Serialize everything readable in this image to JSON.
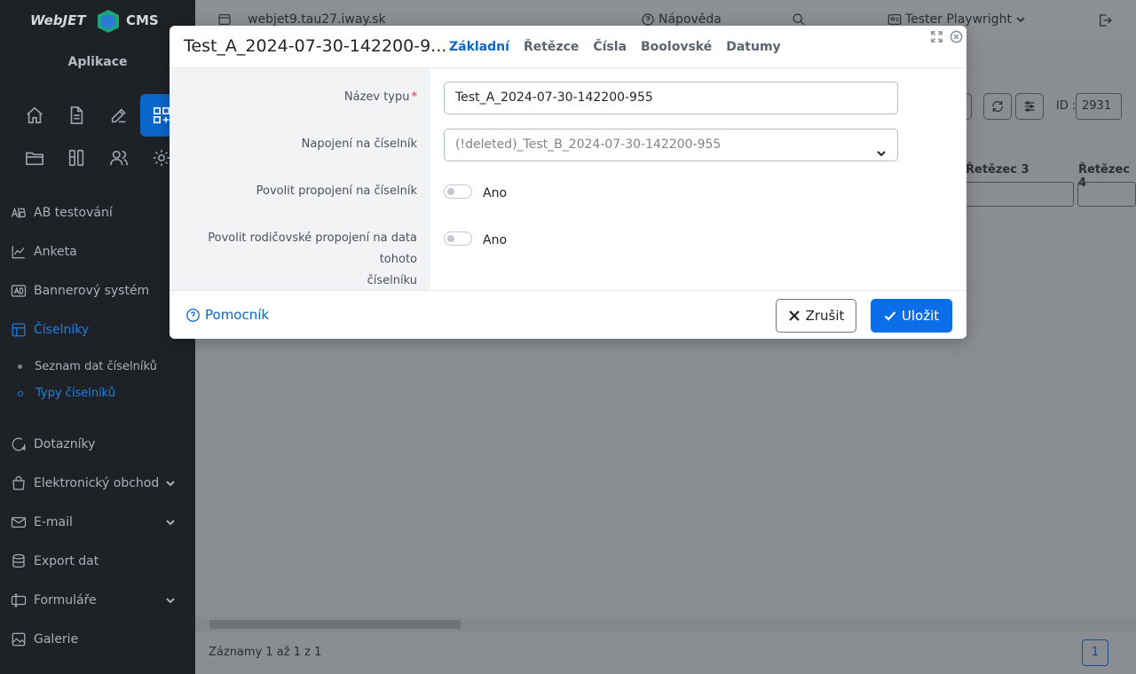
{
  "colors": {
    "accent": "#0a67c9",
    "sidebar_bg": "#1e2227",
    "required": "#dc3545",
    "overlay": "#868b90"
  },
  "sidebar": {
    "logo_text": "WebJET CMS",
    "apps_title": "Aplikace",
    "app_icons": [
      "home-icon",
      "document-icon",
      "edit-icon",
      "apps-grid-icon",
      "folder-icon",
      "columns-icon",
      "users-icon",
      "gear-icon"
    ],
    "nav": [
      {
        "label": "AB testování",
        "icon": "ab-icon"
      },
      {
        "label": "Anketa",
        "icon": "chart-icon"
      },
      {
        "label": "Bannerový systém",
        "icon": "ad-icon"
      },
      {
        "label": "Číselníky",
        "icon": "table-icon",
        "active": true
      },
      {
        "label": "Dotazníky",
        "icon": "chat-icon"
      },
      {
        "label": "Elektronický obchod",
        "icon": "bag-icon",
        "expandable": true
      },
      {
        "label": "E-mail",
        "icon": "mail-icon",
        "expandable": true
      },
      {
        "label": "Export dat",
        "icon": "database-icon"
      },
      {
        "label": "Formuláře",
        "icon": "form-icon",
        "expandable": true
      },
      {
        "label": "Galerie",
        "icon": "image-icon"
      }
    ],
    "sub_items": [
      {
        "label": "Seznam dat číselníků"
      },
      {
        "label": "Typy číselníků",
        "active": true
      }
    ]
  },
  "topbar": {
    "domain": "webjet9.tau27.iway.sk",
    "help": "Nápověda",
    "user": "Tester Playwright"
  },
  "table": {
    "id_label": "ID :",
    "id_value": "2931",
    "columns": [
      "Řetězec 3",
      "Řetězec 4"
    ],
    "footer": "Záznamy 1 až 1 z 1",
    "page": "1"
  },
  "modal": {
    "title": "Test_A_2024-07-30-142200-9...",
    "tabs": [
      "Základní",
      "Řetězce",
      "Čísla",
      "Boolovské",
      "Datumy"
    ],
    "fields": {
      "type_name_label": "Název typu",
      "type_name_value": "Test_A_2024-07-30-142200-955",
      "link_label": "Napojení na číselník",
      "link_value": "(!deleted)_Test_B_2024-07-30-142200-955",
      "allow_link_label": "Povolit propojení na číselník",
      "allow_link_text": "Ano",
      "allow_parent_label_line1": "Povolit rodičovské propojení na data tohoto",
      "allow_parent_label_line2": "číselníku",
      "allow_parent_text": "Ano"
    },
    "footer": {
      "helper": "Pomocník",
      "cancel": "Zrušit",
      "save": "Uložit"
    }
  }
}
